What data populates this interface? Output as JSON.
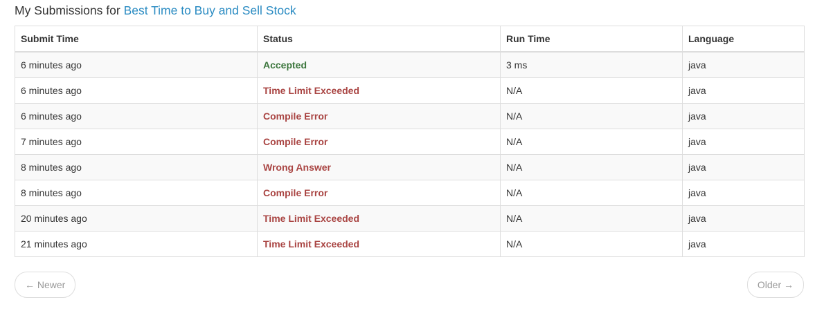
{
  "header": {
    "prefix": "My Submissions for",
    "problem_title": "Best Time to Buy and Sell Stock"
  },
  "table": {
    "columns": [
      "Submit Time",
      "Status",
      "Run Time",
      "Language"
    ],
    "rows": [
      {
        "submit_time": "6 minutes ago",
        "status": "Accepted",
        "run_time": "3 ms",
        "language": "java"
      },
      {
        "submit_time": "6 minutes ago",
        "status": "Time Limit Exceeded",
        "run_time": "N/A",
        "language": "java"
      },
      {
        "submit_time": "6 minutes ago",
        "status": "Compile Error",
        "run_time": "N/A",
        "language": "java"
      },
      {
        "submit_time": "7 minutes ago",
        "status": "Compile Error",
        "run_time": "N/A",
        "language": "java"
      },
      {
        "submit_time": "8 minutes ago",
        "status": "Wrong Answer",
        "run_time": "N/A",
        "language": "java"
      },
      {
        "submit_time": "8 minutes ago",
        "status": "Compile Error",
        "run_time": "N/A",
        "language": "java"
      },
      {
        "submit_time": "20 minutes ago",
        "status": "Time Limit Exceeded",
        "run_time": "N/A",
        "language": "java"
      },
      {
        "submit_time": "21 minutes ago",
        "status": "Time Limit Exceeded",
        "run_time": "N/A",
        "language": "java"
      }
    ]
  },
  "pager": {
    "newer_label": "← Newer",
    "older_label": "Older →"
  },
  "colors": {
    "link": "#2a8bc2",
    "accepted": "#3c763d",
    "error": "#a94442"
  }
}
